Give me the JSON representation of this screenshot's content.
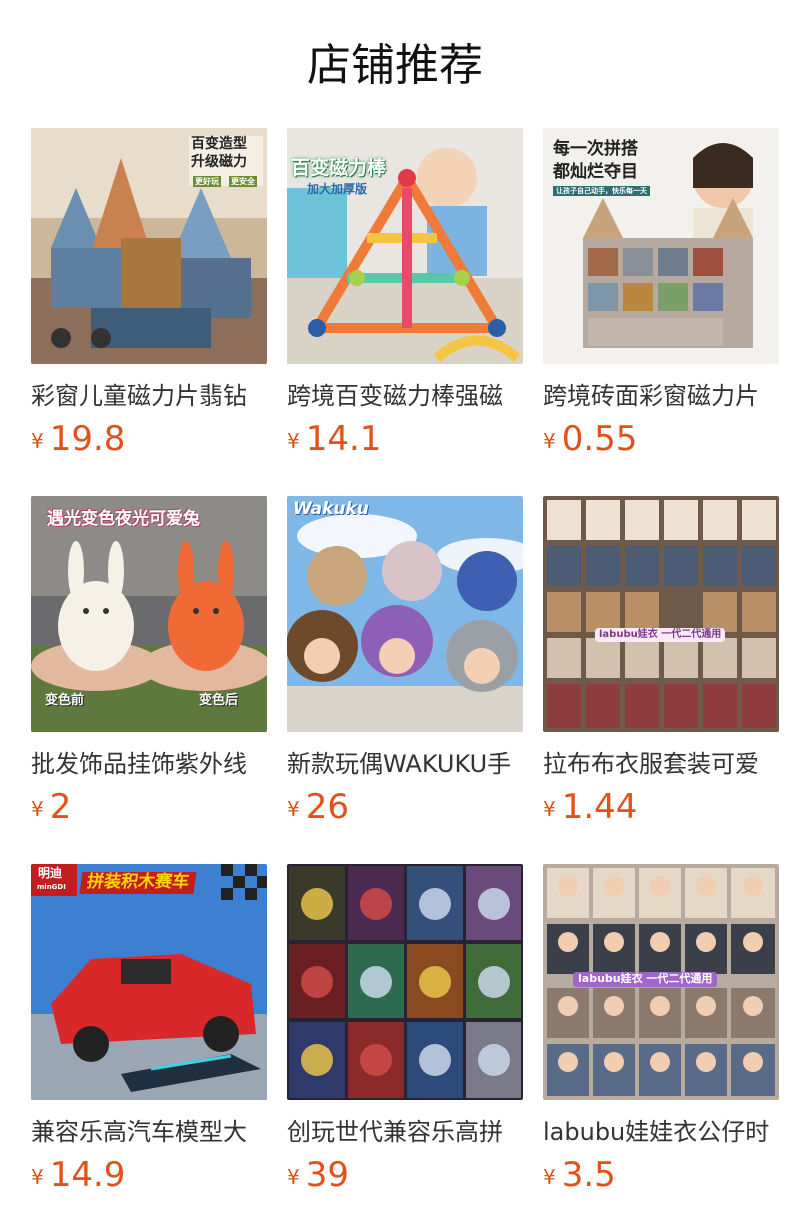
{
  "section_title": "店铺推荐",
  "currency": "¥",
  "products": [
    {
      "name": "彩窗儿童磁力片翡钻",
      "price": "19.8",
      "overlay": [
        "百变造型",
        "升级磁力"
      ],
      "tags": [
        "更好玩",
        "更安全"
      ]
    },
    {
      "name": "跨境百变磁力棒强磁",
      "price": "14.1",
      "overlay": [
        "百变磁力棒",
        "加大加厚版"
      ]
    },
    {
      "name": "跨境砖面彩窗磁力片",
      "price": "0.55",
      "overlay": [
        "每一次拼搭",
        "都灿烂夺目"
      ],
      "tags": [
        "让孩子自己动手，快乐每一天"
      ]
    },
    {
      "name": "批发饰品挂饰紫外线",
      "price": "2",
      "overlay": [
        "遇光变色夜光可爱兔"
      ],
      "tags": [
        "变色前",
        "变色后"
      ]
    },
    {
      "name": "新款玩偶WAKUKU手",
      "price": "26",
      "overlay": [
        "Wakuku"
      ]
    },
    {
      "name": "拉布布衣服套装可爱",
      "price": "1.44",
      "overlay": [
        "labubu娃衣 一代二代通用"
      ]
    },
    {
      "name": "兼容乐高汽车模型大",
      "price": "14.9",
      "overlay": [
        "拼装积木赛车"
      ],
      "tags": [
        "明迪",
        "minGDI"
      ]
    },
    {
      "name": "创玩世代兼容乐高拼",
      "price": "39"
    },
    {
      "name": "labubu娃娃衣公仔时",
      "price": "3.5",
      "overlay": [
        "labubu娃衣 一代二代通用"
      ]
    }
  ],
  "colors": {
    "price": "#e4501a",
    "title": "#111111",
    "name": "#333333"
  }
}
